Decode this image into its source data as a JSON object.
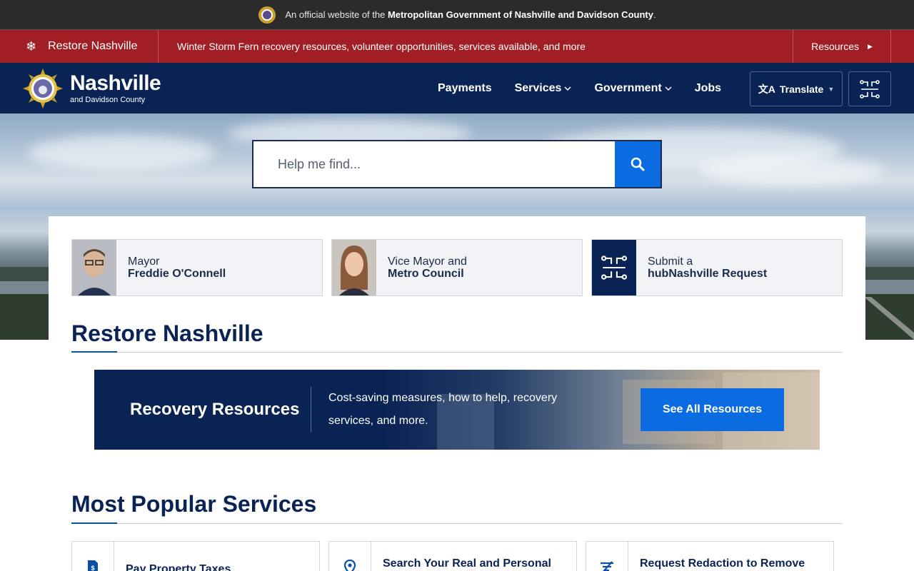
{
  "official_bar": {
    "prefix": "An official website of the",
    "org": "Metropolitan Government of Nashville and Davidson County",
    "suffix": "."
  },
  "alert": {
    "title": "Restore Nashville",
    "message": "Winter Storm Fern recovery resources, volunteer opportunities, services available, and more",
    "link": "Resources"
  },
  "header": {
    "logo_name": "Nashville",
    "logo_sub": "and Davidson County",
    "nav": [
      {
        "label": "Payments",
        "dropdown": false
      },
      {
        "label": "Services",
        "dropdown": true
      },
      {
        "label": "Government",
        "dropdown": true
      },
      {
        "label": "Jobs",
        "dropdown": false
      }
    ],
    "translate": "Translate"
  },
  "search": {
    "placeholder": "Help me find..."
  },
  "cards": [
    {
      "line1": "Mayor",
      "line2": "Freddie O'Connell"
    },
    {
      "line1": "Vice Mayor and",
      "line2": "Metro Council"
    },
    {
      "line1": "Submit a",
      "line2": "hubNashville Request"
    }
  ],
  "restore_section": {
    "title": "Restore Nashville"
  },
  "banner": {
    "title": "Recovery Resources",
    "description": "Cost-saving measures, how to help, recovery services, and more.",
    "button": "See All Resources"
  },
  "popular_section": {
    "title": "Most Popular Services",
    "services": [
      {
        "label": "Pay Property Taxes",
        "icon": "document-dollar-icon"
      },
      {
        "label": "Search Your Real and Personal",
        "icon": "map-pin-icon"
      },
      {
        "label": "Request Redaction to Remove",
        "icon": "filter-lines-icon"
      }
    ]
  },
  "colors": {
    "navy": "#0a2355",
    "alert_red": "#a11f24",
    "accent_blue": "#0b6be0",
    "official_bar": "#2b2b2b"
  }
}
